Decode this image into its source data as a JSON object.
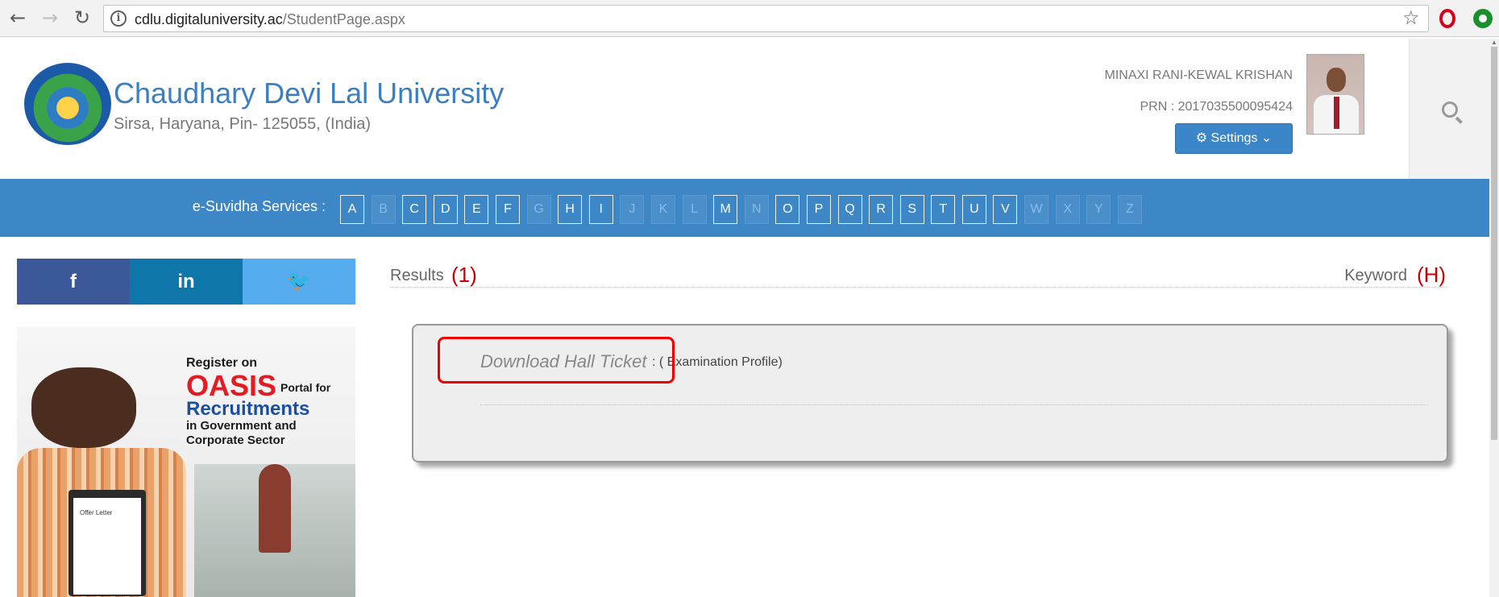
{
  "browser": {
    "back_icon": "back-arrow-icon",
    "forward_icon": "forward-arrow-icon",
    "reload_icon": "reload-icon",
    "url_host": "cdlu.digitaluniversity.ac",
    "url_path": "/StudentPage.aspx",
    "star_glyph": "☆",
    "info_glyph": "i"
  },
  "header": {
    "title": "Chaudhary Devi Lal University",
    "address": "Sirsa, Haryana, Pin- 125055, (India)",
    "user_name": "MINAXI RANI-KEWAL KRISHAN",
    "prn": "PRN : 2017035500095424",
    "settings_label": "⚙ Settings ⌄"
  },
  "services": {
    "label": "e-Suvidha Services :",
    "letters": [
      {
        "l": "A",
        "enabled": true
      },
      {
        "l": "B",
        "enabled": false
      },
      {
        "l": "C",
        "enabled": true
      },
      {
        "l": "D",
        "enabled": true
      },
      {
        "l": "E",
        "enabled": true
      },
      {
        "l": "F",
        "enabled": true
      },
      {
        "l": "G",
        "enabled": false
      },
      {
        "l": "H",
        "enabled": true
      },
      {
        "l": "I",
        "enabled": true
      },
      {
        "l": "J",
        "enabled": false
      },
      {
        "l": "K",
        "enabled": false
      },
      {
        "l": "L",
        "enabled": false
      },
      {
        "l": "M",
        "enabled": true
      },
      {
        "l": "N",
        "enabled": false
      },
      {
        "l": "O",
        "enabled": true
      },
      {
        "l": "P",
        "enabled": true
      },
      {
        "l": "Q",
        "enabled": true
      },
      {
        "l": "R",
        "enabled": true
      },
      {
        "l": "S",
        "enabled": true
      },
      {
        "l": "T",
        "enabled": true
      },
      {
        "l": "U",
        "enabled": true
      },
      {
        "l": "V",
        "enabled": true
      },
      {
        "l": "W",
        "enabled": false
      },
      {
        "l": "X",
        "enabled": false
      },
      {
        "l": "Y",
        "enabled": false
      },
      {
        "l": "Z",
        "enabled": false
      }
    ]
  },
  "social": {
    "facebook": "f",
    "linkedin": "in",
    "twitter": "🐦"
  },
  "banner": {
    "line1": "Register on",
    "line2": "OASIS",
    "line2b": "Portal for",
    "line3": "Recruitments",
    "line4": "in Government and",
    "line5": "Corporate Sector",
    "offer": "Offer Letter"
  },
  "main": {
    "results_label": "Results",
    "results_annotation": "(1)",
    "keyword_label": "Keyword",
    "keyword_annotation": "(H)",
    "result": {
      "link": "Download Hall Ticket",
      "meta": ": ( Examination Profile)"
    }
  },
  "colors": {
    "brand_blue": "#3b7fc1",
    "services_bar": "#3d87c6",
    "annotation_red": "#cc0000"
  }
}
